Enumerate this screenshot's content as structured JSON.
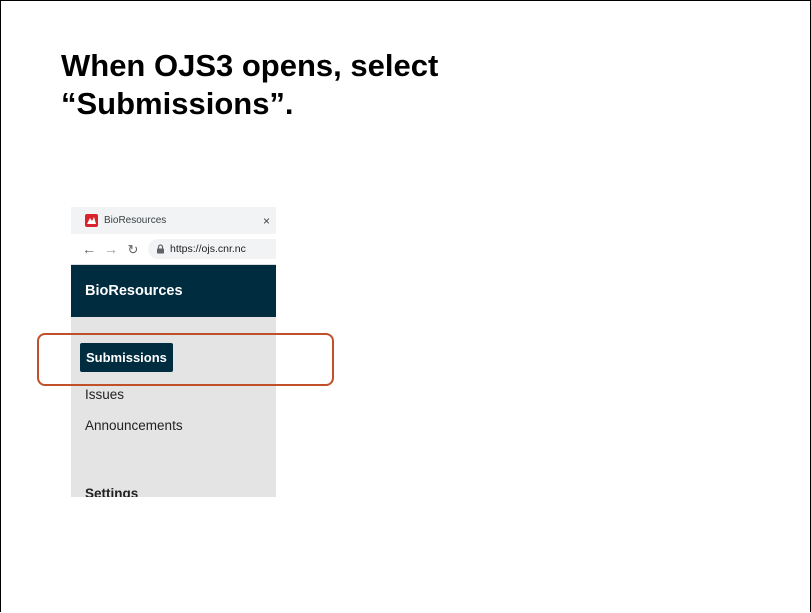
{
  "slide": {
    "title_line1": "When OJS3 opens, select",
    "title_line2": "“Submissions”."
  },
  "browser": {
    "tab_title": "BioResources",
    "tab_close": "×",
    "url": "https://ojs.cnr.nc",
    "icons": {
      "favicon": "favicon-icon",
      "back": "arrow-left-icon",
      "forward": "arrow-right-icon",
      "reload": "reload-icon",
      "lock": "lock-icon"
    },
    "glyphs": {
      "back": "←",
      "forward": "→",
      "reload": "↻"
    }
  },
  "site": {
    "name": "BioResources"
  },
  "nav": {
    "active": "Submissions",
    "items": [
      "Issues",
      "Announcements"
    ],
    "section": "Settings"
  },
  "colors": {
    "header_bg": "#002c40",
    "highlight": "#c0502a",
    "sidebar_bg": "#e4e4e4"
  }
}
